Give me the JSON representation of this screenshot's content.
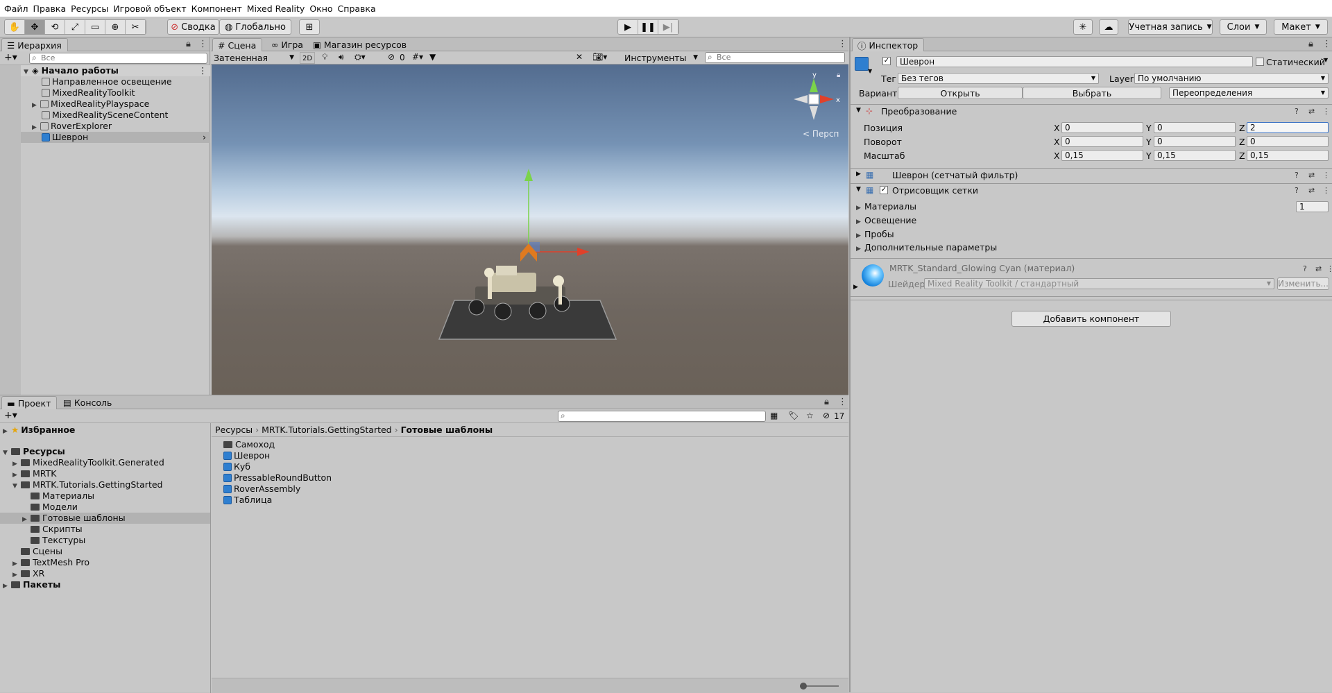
{
  "menu": [
    "Файл",
    "Правка",
    "Ресурсы",
    "Игровой объект",
    "Компонент",
    "Mixed Reality",
    "Окно",
    "Справка"
  ],
  "toolbar": {
    "pivot": "Сводка",
    "global": "Глобально",
    "account": "Учетная запись",
    "layers": "Слои",
    "layout": "Макет"
  },
  "hierarchy": {
    "tab": "Иерархия",
    "search": "Все",
    "scene": "Начало работы",
    "items": [
      "Направленное освещение",
      "MixedRealityToolkit",
      "MixedRealityPlayspace",
      "MixedRealitySceneContent",
      "RoverExplorer",
      "Шеврон"
    ]
  },
  "scene": {
    "tabs": [
      "Сцена",
      "Игра",
      "Магазин ресурсов"
    ],
    "shading": "Затененная",
    "mode2d": "2D",
    "hidden_count": "0",
    "tools": "Инструменты",
    "search": "Все",
    "persp": "< Персп"
  },
  "project": {
    "tabs": [
      "Проект",
      "Консоль"
    ],
    "count": "17",
    "favorites": "Избранное",
    "assets": "Ресурсы",
    "tree": [
      "MixedRealityToolkit.Generated",
      "MRTK",
      "MRTK.Tutorials.GettingStarted",
      "Материалы",
      "Модели",
      "Готовые шаблоны",
      "Скрипты",
      "Текстуры",
      "Сцены",
      "TextMesh Pro",
      "XR"
    ],
    "packages": "Пакеты",
    "breadcrumb": [
      "Ресурсы",
      "MRTK.Tutorials.GettingStarted",
      "Готовые шаблоны"
    ],
    "files": [
      "Самоход",
      "Шеврон",
      "Куб",
      "PressableRoundButton",
      "RoverAssembly",
      "Таблица"
    ]
  },
  "inspector": {
    "tab": "Инспектор",
    "name": "Шеврон",
    "static": "Статический",
    "tag_label": "Тег",
    "tag": "Без тегов",
    "layer_label": "Layer",
    "layer": "По умолчанию",
    "variant": "Вариант",
    "open": "Открыть",
    "select": "Выбрать",
    "overrides": "Переопределения",
    "transform": "Преобразование",
    "position": "Позиция",
    "rotation": "Поворот",
    "scale": "Масштаб",
    "pos": [
      "0",
      "0",
      "2"
    ],
    "rot": [
      "0",
      "0",
      "0"
    ],
    "scl": [
      "0,15",
      "0,15",
      "0,15"
    ],
    "meshfilter": "Шеврон (сетчатый фильтр)",
    "renderer": "Отрисовщик сетки",
    "materials": "Материалы",
    "materials_count": "1",
    "lighting": "Освещение",
    "probes": "Пробы",
    "additional": "Дополнительные параметры",
    "material_name": "MRTK_Standard_Glowing Cyan (материал)",
    "shader_label": "Шейдер",
    "shader": "Mixed Reality Toolkit / стандартный",
    "edit": "Изменить...",
    "add_component": "Добавить компонент"
  }
}
